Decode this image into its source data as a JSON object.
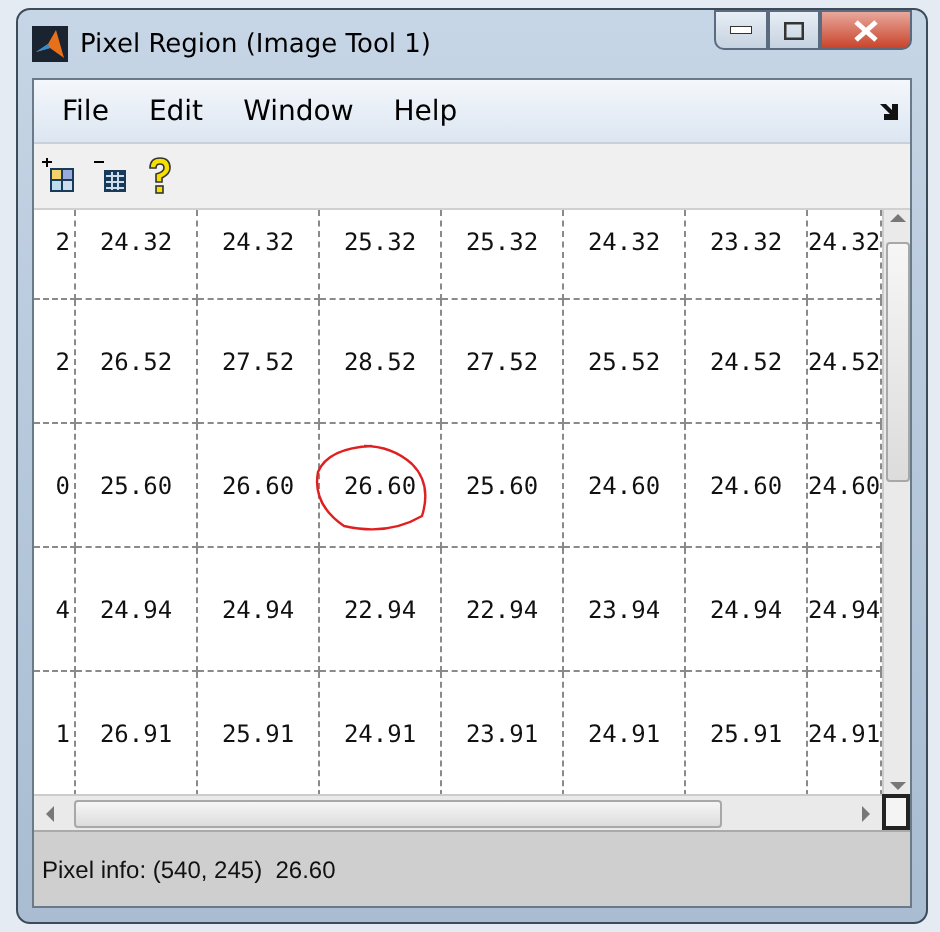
{
  "window": {
    "title": "Pixel Region (Image Tool 1)"
  },
  "menu": [
    "File",
    "Edit",
    "Window",
    "Help"
  ],
  "grid": {
    "rows": [
      {
        "edge": "2",
        "cells": [
          {
            "value": "24.32",
            "circled": false
          },
          {
            "value": "24.32",
            "circled": false
          },
          {
            "value": "25.32",
            "circled": false
          },
          {
            "value": "25.32",
            "circled": false
          },
          {
            "value": "24.32",
            "circled": false
          },
          {
            "value": "23.32",
            "circled": false
          },
          {
            "value": "24.32",
            "circled": false
          }
        ]
      },
      {
        "edge": "2",
        "cells": [
          {
            "value": "26.52",
            "circled": false
          },
          {
            "value": "27.52",
            "circled": false
          },
          {
            "value": "28.52",
            "circled": false
          },
          {
            "value": "27.52",
            "circled": false
          },
          {
            "value": "25.52",
            "circled": false
          },
          {
            "value": "24.52",
            "circled": false
          },
          {
            "value": "24.52",
            "circled": false
          }
        ]
      },
      {
        "edge": "0",
        "cells": [
          {
            "value": "25.60",
            "circled": false
          },
          {
            "value": "26.60",
            "circled": false
          },
          {
            "value": "26.60",
            "circled": true
          },
          {
            "value": "25.60",
            "circled": false
          },
          {
            "value": "24.60",
            "circled": false
          },
          {
            "value": "24.60",
            "circled": false
          },
          {
            "value": "24.60",
            "circled": false
          }
        ]
      },
      {
        "edge": "4",
        "cells": [
          {
            "value": "24.94",
            "circled": false
          },
          {
            "value": "24.94",
            "circled": false
          },
          {
            "value": "22.94",
            "circled": false
          },
          {
            "value": "22.94",
            "circled": false
          },
          {
            "value": "23.94",
            "circled": false
          },
          {
            "value": "24.94",
            "circled": false
          },
          {
            "value": "24.94",
            "circled": false
          }
        ]
      },
      {
        "edge": "1",
        "cells": [
          {
            "value": "26.91",
            "circled": false
          },
          {
            "value": "25.91",
            "circled": false
          },
          {
            "value": "24.91",
            "circled": false
          },
          {
            "value": "23.91",
            "circled": false
          },
          {
            "value": "24.91",
            "circled": false
          },
          {
            "value": "25.91",
            "circled": false
          },
          {
            "value": "24.91",
            "circled": false
          }
        ]
      }
    ]
  },
  "status_bar": "Pixel info: (540, 245)  26.60"
}
